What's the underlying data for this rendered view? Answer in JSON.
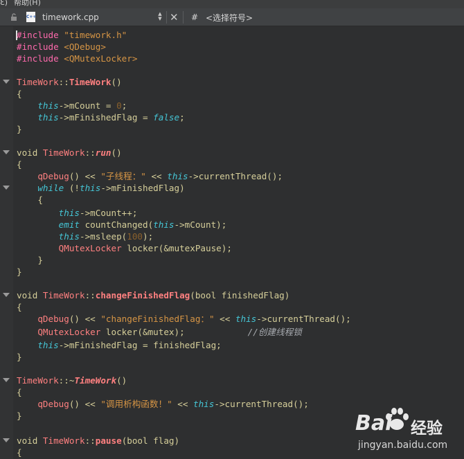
{
  "menubar": {
    "items": [
      "Ɛ)",
      "帮助(H)"
    ]
  },
  "tabbar": {
    "filename": "timework.cpp",
    "hash": "#",
    "symbols": "<选择符号>",
    "file_icon_label": "C++"
  },
  "code": {
    "l1": [
      {
        "t": "#include",
        "c": "pp"
      },
      {
        "t": " "
      },
      {
        "t": "\"timework.h\"",
        "c": "str"
      }
    ],
    "l2": [
      {
        "t": "#include",
        "c": "pp"
      },
      {
        "t": " "
      },
      {
        "t": "<QDebug>",
        "c": "str"
      }
    ],
    "l3": [
      {
        "t": "#include",
        "c": "pp"
      },
      {
        "t": " "
      },
      {
        "t": "<QMutexLocker>",
        "c": "str"
      }
    ],
    "l5": [
      {
        "t": "TimeWork",
        "c": "cls"
      },
      {
        "t": "::"
      },
      {
        "t": "TimeWork",
        "c": "cls-b"
      },
      {
        "t": "()"
      }
    ],
    "l6": [
      {
        "t": "{"
      }
    ],
    "l7": [
      {
        "t": "    "
      },
      {
        "t": "this",
        "c": "kw"
      },
      {
        "t": "->mCount = "
      },
      {
        "t": "0",
        "c": "num"
      },
      {
        "t": ";"
      }
    ],
    "l8": [
      {
        "t": "    "
      },
      {
        "t": "this",
        "c": "kw"
      },
      {
        "t": "->mFinishedFlag = "
      },
      {
        "t": "false",
        "c": "kw"
      },
      {
        "t": ";"
      }
    ],
    "l9": [
      {
        "t": "}"
      }
    ],
    "l11": [
      {
        "t": "void "
      },
      {
        "t": "TimeWork",
        "c": "cls"
      },
      {
        "t": "::"
      },
      {
        "t": "run",
        "c": "fnc-i"
      },
      {
        "t": "()"
      }
    ],
    "l12": [
      {
        "t": "{"
      }
    ],
    "l13": [
      {
        "t": "    "
      },
      {
        "t": "qDebug",
        "c": "fnc"
      },
      {
        "t": "() << "
      },
      {
        "t": "\"子线程：\"",
        "c": "str"
      },
      {
        "t": " << "
      },
      {
        "t": "this",
        "c": "kw"
      },
      {
        "t": "->currentThread();"
      }
    ],
    "l14": [
      {
        "t": "    "
      },
      {
        "t": "while",
        "c": "kw"
      },
      {
        "t": " (!"
      },
      {
        "t": "this",
        "c": "kw"
      },
      {
        "t": "->mFinishedFlag)"
      }
    ],
    "l15": [
      {
        "t": "    {"
      }
    ],
    "l16": [
      {
        "t": "        "
      },
      {
        "t": "this",
        "c": "kw"
      },
      {
        "t": "->mCount++;"
      }
    ],
    "l17": [
      {
        "t": "        "
      },
      {
        "t": "emit",
        "c": "kw"
      },
      {
        "t": " countChanged("
      },
      {
        "t": "this",
        "c": "kw"
      },
      {
        "t": "->mCount);"
      }
    ],
    "l18": [
      {
        "t": "        "
      },
      {
        "t": "this",
        "c": "kw"
      },
      {
        "t": "->msleep("
      },
      {
        "t": "100",
        "c": "num"
      },
      {
        "t": ");"
      }
    ],
    "l19": [
      {
        "t": "        "
      },
      {
        "t": "QMutexLocker",
        "c": "cls"
      },
      {
        "t": " locker(&mutexPause);"
      }
    ],
    "l20": [
      {
        "t": "    }"
      }
    ],
    "l21": [
      {
        "t": "}"
      }
    ],
    "l23": [
      {
        "t": "void "
      },
      {
        "t": "TimeWork",
        "c": "cls"
      },
      {
        "t": "::"
      },
      {
        "t": "changeFinishedFlag",
        "c": "fnc-b"
      },
      {
        "t": "(bool finishedFlag)"
      }
    ],
    "l24": [
      {
        "t": "{"
      }
    ],
    "l25": [
      {
        "t": "    "
      },
      {
        "t": "qDebug",
        "c": "fnc"
      },
      {
        "t": "() << "
      },
      {
        "t": "\"changeFinishedFlag：\"",
        "c": "str"
      },
      {
        "t": " << "
      },
      {
        "t": "this",
        "c": "kw"
      },
      {
        "t": "->currentThread();"
      }
    ],
    "l26": [
      {
        "t": "    "
      },
      {
        "t": "QMutexLocker",
        "c": "cls"
      },
      {
        "t": " locker(&mutex);            "
      },
      {
        "t": "//创建线程锁",
        "c": "cmt"
      }
    ],
    "l27": [
      {
        "t": "    "
      },
      {
        "t": "this",
        "c": "kw"
      },
      {
        "t": "->mFinishedFlag = finishedFlag;"
      }
    ],
    "l28": [
      {
        "t": "}"
      }
    ],
    "l30": [
      {
        "t": "TimeWork",
        "c": "cls"
      },
      {
        "t": "::~"
      },
      {
        "t": "TimeWork",
        "c": "cls-i"
      },
      {
        "t": "()"
      }
    ],
    "l31": [
      {
        "t": "{"
      }
    ],
    "l32": [
      {
        "t": "    "
      },
      {
        "t": "qDebug",
        "c": "fnc"
      },
      {
        "t": "() << "
      },
      {
        "t": "\"调用析构函数！\"",
        "c": "str"
      },
      {
        "t": " << "
      },
      {
        "t": "this",
        "c": "kw"
      },
      {
        "t": "->currentThread();"
      }
    ],
    "l33": [
      {
        "t": "}"
      }
    ],
    "l35": [
      {
        "t": "void "
      },
      {
        "t": "TimeWork",
        "c": "cls"
      },
      {
        "t": "::"
      },
      {
        "t": "pause",
        "c": "fnc-b"
      },
      {
        "t": "(bool flag)"
      }
    ],
    "l36": [
      {
        "t": "{"
      }
    ]
  },
  "watermark": {
    "brand": "Bai",
    "cn": "经验",
    "url": "jingyan.baidu.com"
  },
  "colors": {
    "background": "#2e2f30",
    "preprocessor": "#ff6aad",
    "string": "#d69545",
    "class": "#ff8080",
    "keyword": "#45c6d6",
    "number": "#8a602c",
    "plain": "#d6cf9a"
  }
}
